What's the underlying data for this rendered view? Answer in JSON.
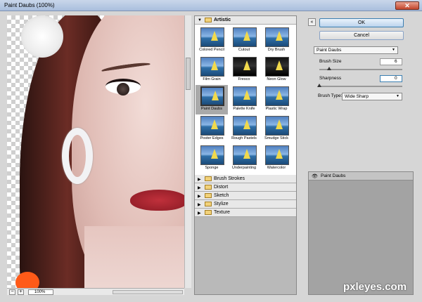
{
  "window": {
    "title": "Paint Daubs (100%)",
    "close_glyph": "✕"
  },
  "preview": {
    "zoom": "100%",
    "minus": "−",
    "plus": "+"
  },
  "gallery": {
    "open_category": "Artistic",
    "thumbs": [
      {
        "name": "Colored Pencil"
      },
      {
        "name": "Cutout"
      },
      {
        "name": "Dry Brush"
      },
      {
        "name": "Film Grain"
      },
      {
        "name": "Fresco"
      },
      {
        "name": "Neon Glow"
      },
      {
        "name": "Paint Daubs"
      },
      {
        "name": "Palette Knife"
      },
      {
        "name": "Plastic Wrap"
      },
      {
        "name": "Poster Edges"
      },
      {
        "name": "Rough Pastels"
      },
      {
        "name": "Smudge Stick"
      },
      {
        "name": "Sponge"
      },
      {
        "name": "Underpainting"
      },
      {
        "name": "Watercolor"
      }
    ],
    "selected": "Paint Daubs",
    "categories": [
      "Brush Strokes",
      "Distort",
      "Sketch",
      "Stylize",
      "Texture"
    ]
  },
  "controls": {
    "ok": "OK",
    "cancel": "Cancel",
    "filter": "Paint Daubs",
    "brush_size_label": "Brush Size",
    "brush_size_value": "6",
    "brush_size_fraction": 0.12,
    "sharpness_label": "Sharpness",
    "sharpness_value": "0",
    "sharpness_fraction": 0.0,
    "brush_type_label": "Brush Type:",
    "brush_type_value": "Wide Sharp"
  },
  "layers": {
    "items": [
      "Paint Daubs"
    ]
  },
  "watermark": "pxleyes.com"
}
